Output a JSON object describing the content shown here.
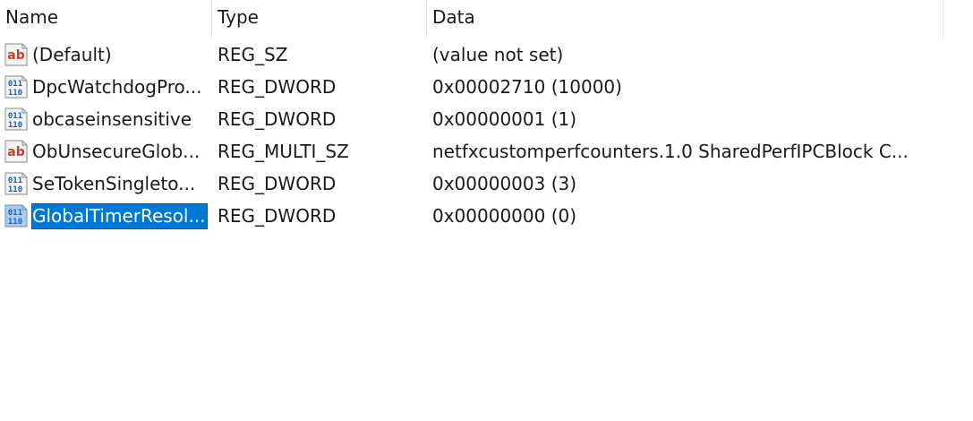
{
  "columns": {
    "name": "Name",
    "type": "Type",
    "data": "Data"
  },
  "rows": [
    {
      "icon": "string-value-icon",
      "name": "(Default)",
      "type": "REG_SZ",
      "data": "(value not set)",
      "selected": false
    },
    {
      "icon": "binary-value-icon",
      "name": "DpcWatchdogPro...",
      "type": "REG_DWORD",
      "data": "0x00002710 (10000)",
      "selected": false
    },
    {
      "icon": "binary-value-icon",
      "name": "obcaseinsensitive",
      "type": "REG_DWORD",
      "data": "0x00000001 (1)",
      "selected": false
    },
    {
      "icon": "string-value-icon",
      "name": "ObUnsecureGlob...",
      "type": "REG_MULTI_SZ",
      "data": "netfxcustomperfcounters.1.0 SharedPerfIPCBlock C...",
      "selected": false
    },
    {
      "icon": "binary-value-icon",
      "name": "SeTokenSingleto...",
      "type": "REG_DWORD",
      "data": "0x00000003 (3)",
      "selected": false
    },
    {
      "icon": "binary-value-icon",
      "name": "GlobalTimerResol...",
      "type": "REG_DWORD",
      "data": "0x00000000 (0)",
      "selected": true
    }
  ],
  "colors": {
    "selection": "#0078d7",
    "string_icon_text": "#c8412b",
    "binary_icon_text": "#1f5fb6"
  }
}
